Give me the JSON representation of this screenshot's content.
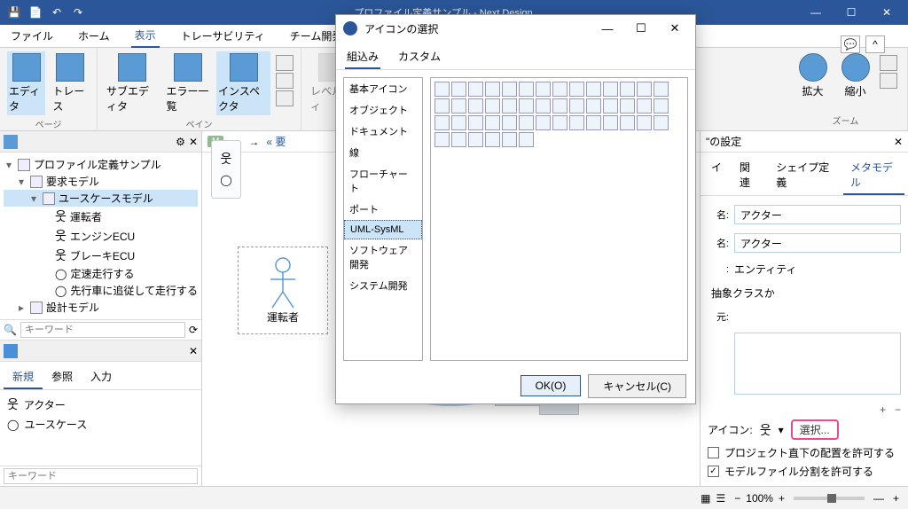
{
  "window": {
    "title": "プロファイル定義サンプル - Next Design"
  },
  "menu": {
    "file": "ファイル",
    "home": "ホーム",
    "view": "表示",
    "trace": "トレーサビリティ",
    "team": "チーム開発"
  },
  "ribbon": {
    "page": "ページ",
    "pane": "ペイン",
    "zoom": "ズーム",
    "editor": "エディタ",
    "treeBtn": "トレース",
    "subEditor": "サブエディタ",
    "errorList": "エラー一覧",
    "inspector": "インスペクタ",
    "levelFilter": "レベルフィ",
    "zoomIn": "拡大",
    "zoomOut": "縮小"
  },
  "rp": {
    "title": "\"の設定",
    "tab1": "イ",
    "tab2": "関連",
    "tab3": "シェイプ定義",
    "tab4": "メタモデル",
    "nameLbl": "名:",
    "name1": "アクター",
    "name2": "アクター",
    "entity": "エンティティ",
    "abstract": "抽象クラスか",
    "from": "元:",
    "iconLbl": "アイコン:",
    "select": "選択...",
    "chk1": "プロジェクト直下の配置を許可する",
    "chk2": "モデルファイル分割を許可する"
  },
  "tree": {
    "root": "プロファイル定義サンプル",
    "n1": "要求モデル",
    "n2": "ユースケースモデル",
    "c1": "運転者",
    "c2": "エンジンECU",
    "c3": "ブレーキECU",
    "c4": "定速走行する",
    "c5": "先行車に追従して走行する",
    "n3": "設計モデル",
    "kw": "キーワード"
  },
  "tabs": {
    "new": "新規",
    "ref": "参照",
    "input": "入力"
  },
  "list": {
    "actor": "アクター",
    "usecase": "ユースケース"
  },
  "kw2": "キーワード",
  "canvas": {
    "m": "M",
    "req": "要",
    "actorLabel": "運転者"
  },
  "modal": {
    "title": "アイコンの選択",
    "tab1": "組込み",
    "tab2": "カスタム",
    "ok": "OK(O)",
    "cancel": "キャンセル(C)",
    "cats": [
      "基本アイコン",
      "オブジェクト",
      "ドキュメント",
      "線",
      "フローチャート",
      "ポート",
      "UML-SysML",
      "ソフトウェア開発",
      "システム開発"
    ]
  },
  "status": {
    "zoom": "100%"
  }
}
